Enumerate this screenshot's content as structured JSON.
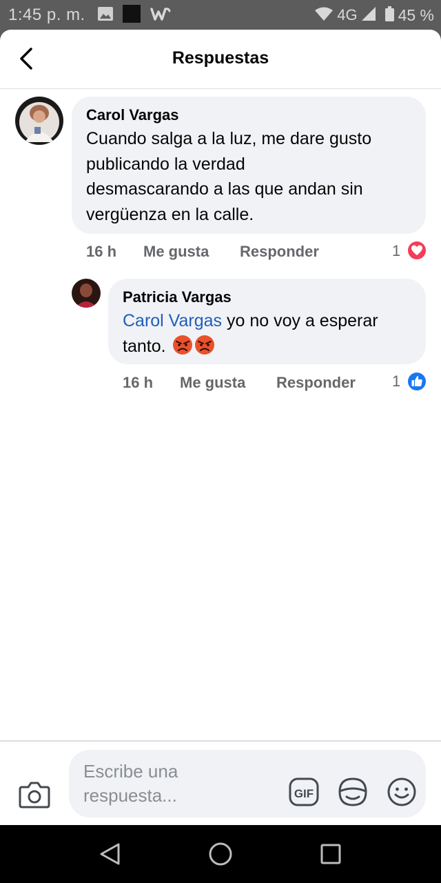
{
  "status_bar": {
    "time": "1:45 p. m.",
    "network": "4G",
    "battery": "45 %",
    "left_icons": [
      "gallery-icon",
      "square-icon",
      "wattpad-icon"
    ],
    "right_icons": [
      "wifi-icon",
      "signal-icon",
      "battery-icon"
    ]
  },
  "header": {
    "title": "Respuestas",
    "back_icon": "chevron-left-icon"
  },
  "comments": [
    {
      "author": "Carol Vargas",
      "text_lines": [
        "Cuando salga a la luz, me dare gusto",
        "publicando la verdad",
        "desmascarando a las que andan sin",
        "vergüenza en la calle."
      ],
      "time": "16 h",
      "like_label": "Me gusta",
      "reply_label": "Responder",
      "reaction_count": "1",
      "reaction_type": "love",
      "reaction_color": "#f33e58"
    },
    {
      "author": "Patricia Vargas",
      "mention": "Carol Vargas",
      "text_line1_rest": " yo no voy a esperar",
      "text_line2": "tanto.",
      "emojis": [
        "angry-face-emoji",
        "angry-face-emoji"
      ],
      "time": "16 h",
      "like_label": "Me gusta",
      "reply_label": "Responder",
      "reaction_count": "1",
      "reaction_type": "like",
      "reaction_color": "#1877f2"
    }
  ],
  "composer": {
    "placeholder_line1": "Escribe una",
    "placeholder_line2": "respuesta...",
    "tools": [
      "camera-icon",
      "gif-icon",
      "sticker-icon",
      "emoji-icon"
    ],
    "gif_label": "GIF"
  },
  "nav_bar": {
    "buttons": [
      "back-triangle-icon",
      "home-circle-icon",
      "recents-square-icon"
    ]
  },
  "colors": {
    "mention": "#1f5dbd",
    "bubble": "#f0f2f5",
    "secondary_text": "#65676b"
  }
}
